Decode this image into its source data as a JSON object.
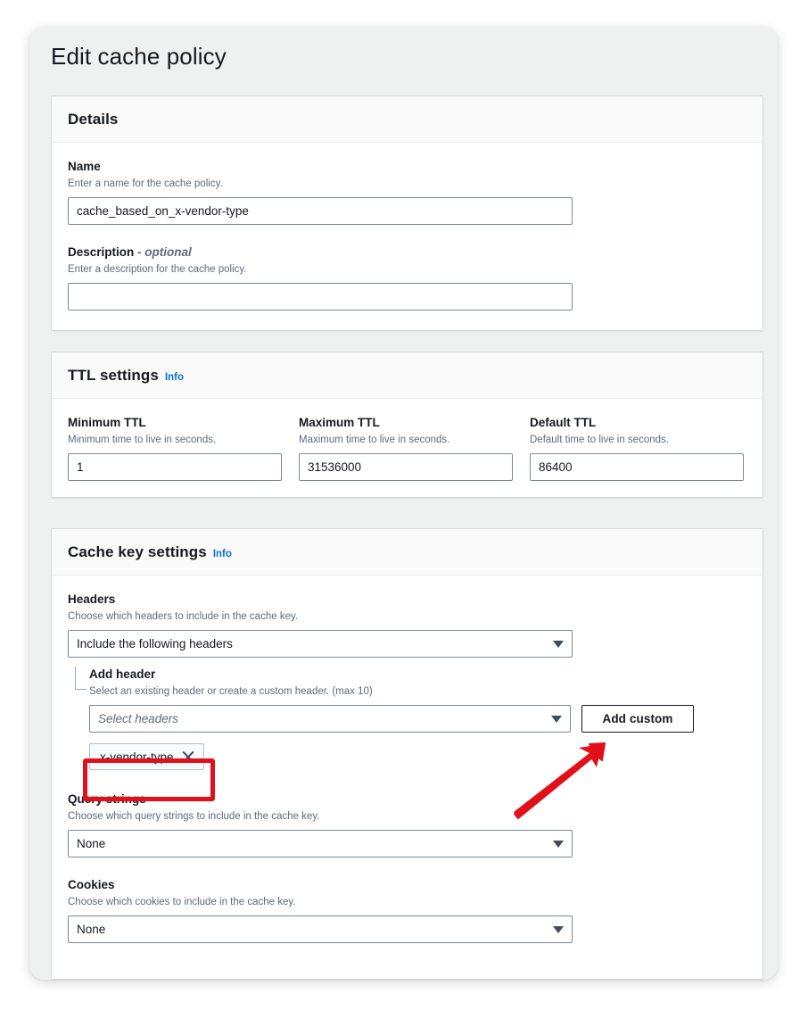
{
  "page": {
    "title": "Edit cache policy"
  },
  "sections": {
    "details": {
      "heading": "Details",
      "name_field": {
        "label": "Name",
        "description": "Enter a name for the cache policy.",
        "value": "cache_based_on_x-vendor-type",
        "placeholder": ""
      },
      "description_field": {
        "label": "Description",
        "label_optional": "- optional",
        "description": "Enter a description for the cache policy.",
        "value": "",
        "placeholder": ""
      }
    },
    "ttl": {
      "heading": "TTL settings",
      "info_label": "Info",
      "fields": [
        {
          "label": "Minimum TTL",
          "description": "Minimum time to live in seconds.",
          "value": "1"
        },
        {
          "label": "Maximum TTL",
          "description": "Maximum time to live in seconds.",
          "value": "31536000"
        },
        {
          "label": "Default TTL",
          "description": "Default time to live in seconds.",
          "value": "86400"
        }
      ]
    },
    "cache_key": {
      "heading": "Cache key settings",
      "info_label": "Info",
      "headers": {
        "label": "Headers",
        "description": "Choose which headers to include in the cache key.",
        "selected": "Include the following headers"
      },
      "add_header": {
        "label": "Add header",
        "description": "Select an existing header or create a custom header. (max 10)",
        "placeholder": "Select headers",
        "add_custom_label": "Add custom",
        "tokens": [
          {
            "label": "x-vendor-type"
          }
        ]
      },
      "query_strings": {
        "label": "Query strings",
        "description": "Choose which query strings to include in the cache key.",
        "selected": "None"
      },
      "cookies": {
        "label": "Cookies",
        "description": "Choose which cookies to include in the cache key.",
        "selected": "None"
      }
    }
  },
  "annotations": {
    "highlight_color": "#e11019",
    "arrow_color": "#e11019"
  }
}
